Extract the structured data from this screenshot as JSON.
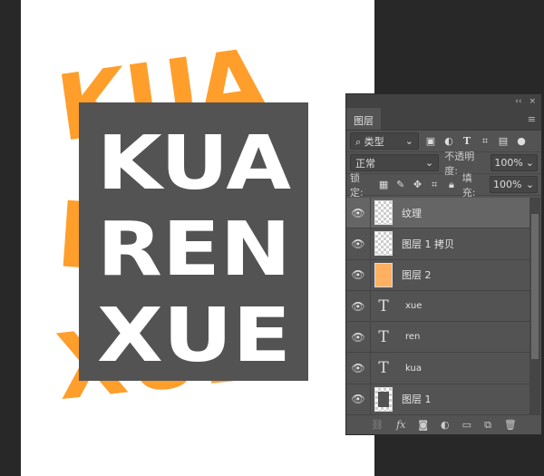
{
  "artwork": {
    "lines": [
      "KUA",
      "REN",
      "XUE"
    ],
    "colors": {
      "orange": "#ff9e2a",
      "box": "#535353",
      "white": "#ffffff"
    }
  },
  "panel": {
    "header_icons": [
      "collapse-icon",
      "close-icon"
    ],
    "collapse": "‹‹",
    "close": "×",
    "tab": "图层",
    "menu": "≡",
    "filter": {
      "label": "类型",
      "icons": [
        "image-filter-icon",
        "adjustment-filter-icon",
        "text-filter-icon",
        "shape-filter-icon",
        "smart-object-filter-icon"
      ]
    },
    "blend": {
      "mode": "正常",
      "opacity_label": "不透明度:",
      "opacity": "100%"
    },
    "lock": {
      "label": "锁定:",
      "fill_label": "填充:",
      "fill": "100%"
    },
    "layers": [
      {
        "name": "纹理",
        "type": "image",
        "selected": true
      },
      {
        "name": "图层 1 拷贝",
        "type": "image"
      },
      {
        "name": "图层 2",
        "type": "image"
      },
      {
        "name": "xue",
        "type": "text"
      },
      {
        "name": "ren",
        "type": "text"
      },
      {
        "name": "kua",
        "type": "text"
      },
      {
        "name": "图层 1",
        "type": "image"
      }
    ],
    "footer": {
      "fx": "fx"
    }
  }
}
